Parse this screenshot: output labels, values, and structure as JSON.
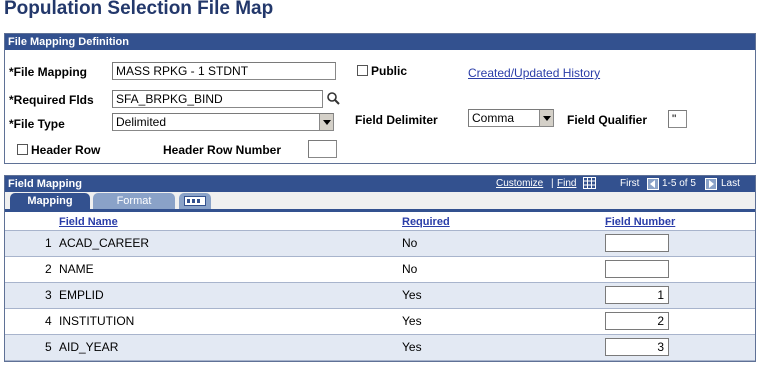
{
  "page": {
    "title": "Population Selection File Map"
  },
  "definition": {
    "header": "File Mapping Definition",
    "file_mapping_label": "*File Mapping",
    "file_mapping_value": "MASS RPKG - 1 STDNT",
    "public_label": "Public",
    "history_link": "Created/Updated History",
    "required_flds_label": "*Required Flds",
    "required_flds_value": "SFA_BRPKG_BIND",
    "file_type_label": "*File Type",
    "file_type_value": "Delimited",
    "field_delimiter_label": "Field Delimiter",
    "field_delimiter_value": "Comma",
    "field_qualifier_label": "Field Qualifier",
    "field_qualifier_value": "\"",
    "header_row_label": "Header Row",
    "header_row_number_label": "Header Row Number",
    "header_row_number_value": ""
  },
  "field_mapping": {
    "header": "Field Mapping",
    "customize": "Customize",
    "find": "Find",
    "separator": "|",
    "first": "First",
    "range": "1-5 of 5",
    "last": "Last",
    "tabs": [
      {
        "label": "Mapping",
        "active": true
      },
      {
        "label": "Format",
        "active": false
      }
    ],
    "columns": {
      "field_name": "Field Name",
      "required": "Required",
      "field_number": "Field Number"
    },
    "rows": [
      {
        "num": "1",
        "field_name": "ACAD_CAREER",
        "required": "No",
        "field_number": ""
      },
      {
        "num": "2",
        "field_name": "NAME",
        "required": "No",
        "field_number": ""
      },
      {
        "num": "3",
        "field_name": "EMPLID",
        "required": "Yes",
        "field_number": "1"
      },
      {
        "num": "4",
        "field_name": "INSTITUTION",
        "required": "Yes",
        "field_number": "2"
      },
      {
        "num": "5",
        "field_name": "AID_YEAR",
        "required": "Yes",
        "field_number": "3"
      }
    ]
  }
}
